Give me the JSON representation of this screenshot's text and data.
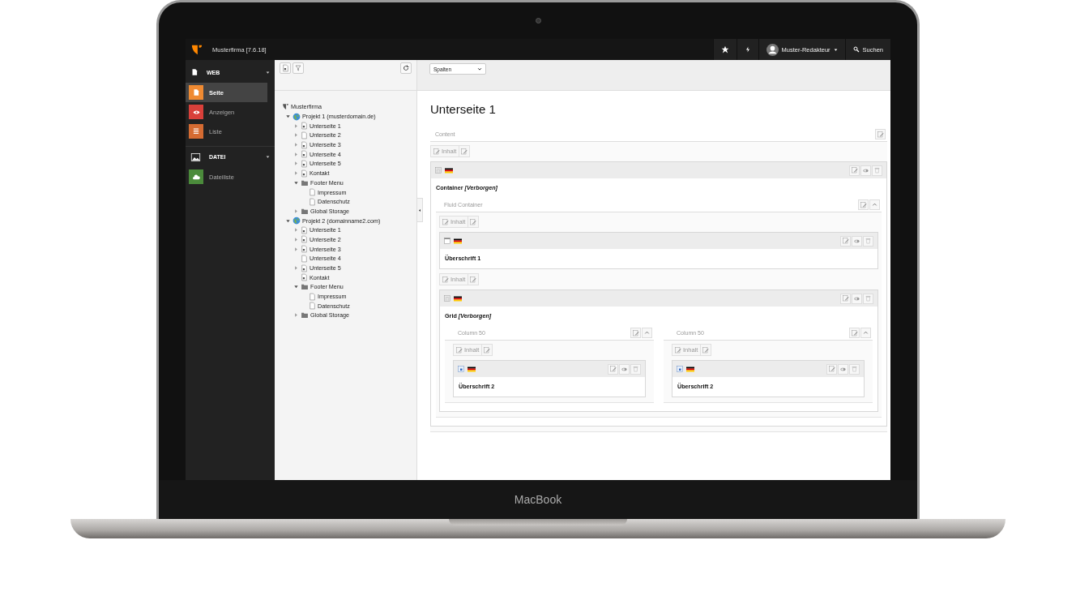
{
  "device_label": "MacBook",
  "topbar": {
    "title": "Musterfirma [7.6.18]",
    "user": "Muster-Redakteur",
    "search": "Suchen"
  },
  "modules": [
    {
      "label": "WEB",
      "kind": "page",
      "items": [
        {
          "label": "Seite",
          "kind": "page",
          "color": "#ef8a32",
          "selected": true
        },
        {
          "label": "Anzeigen",
          "kind": "eye",
          "color": "#d9403a",
          "selected": false
        },
        {
          "label": "Liste",
          "kind": "list",
          "color": "#d56b32",
          "selected": false
        }
      ]
    },
    {
      "label": "DATEI",
      "kind": "image",
      "items": [
        {
          "label": "Dateiliste",
          "kind": "cloud",
          "color": "#4b8b3b",
          "selected": false
        }
      ]
    }
  ],
  "tree": {
    "label": "Musterfirma",
    "kind": "root",
    "children": [
      {
        "label": "Projekt 1 (musterdomain.de)",
        "kind": "globe",
        "expanded": true,
        "children": [
          {
            "label": "Unterseite 1",
            "kind": "page",
            "expanded": false
          },
          {
            "label": "Unterseite 2",
            "kind": "page-plain",
            "expanded": false
          },
          {
            "label": "Unterseite 3",
            "kind": "page",
            "expanded": false
          },
          {
            "label": "Unterseite 4",
            "kind": "page",
            "expanded": false
          },
          {
            "label": "Unterseite 5",
            "kind": "page",
            "expanded": false
          },
          {
            "label": "Kontakt",
            "kind": "page",
            "expanded": false
          },
          {
            "label": "Footer Menu",
            "kind": "folder",
            "expanded": true,
            "children": [
              {
                "label": "Impressum",
                "kind": "page-plain"
              },
              {
                "label": "Datenschutz",
                "kind": "page-plain"
              }
            ]
          },
          {
            "label": "Global Storage",
            "kind": "folder",
            "expanded": false
          }
        ]
      },
      {
        "label": "Projekt 2 (domainname2.com)",
        "kind": "globe",
        "expanded": true,
        "children": [
          {
            "label": "Unterseite 1",
            "kind": "page",
            "expanded": false
          },
          {
            "label": "Unterseite 2",
            "kind": "page",
            "expanded": false
          },
          {
            "label": "Unterseite 3",
            "kind": "page",
            "expanded": false
          },
          {
            "label": "Unterseite 4",
            "kind": "page-plain"
          },
          {
            "label": "Unterseite 5",
            "kind": "page",
            "expanded": false
          },
          {
            "label": "Kontakt",
            "kind": "page"
          },
          {
            "label": "Footer Menu",
            "kind": "folder",
            "expanded": true,
            "children": [
              {
                "label": "Impressum",
                "kind": "page-plain"
              },
              {
                "label": "Datenschutz",
                "kind": "page-plain"
              }
            ]
          },
          {
            "label": "Global Storage",
            "kind": "folder",
            "expanded": false
          }
        ]
      }
    ]
  },
  "view_select": "Spalten",
  "page_title": "Unterseite 1",
  "column": {
    "label": "Content",
    "collapsible": false,
    "items": [
      {
        "kind": "add",
        "label": "Inhalt"
      },
      {
        "kind": "container",
        "title": "Container *[Verborgen]*",
        "columns": [
          {
            "label": "Fluid Container",
            "collapsible": true,
            "items": [
              {
                "kind": "add",
                "label": "Inhalt"
              },
              {
                "kind": "header",
                "title": "Überschrift 1"
              },
              {
                "kind": "add",
                "label": "Inhalt"
              },
              {
                "kind": "container",
                "title": "Grid *[Verborgen]*",
                "columns": [
                  {
                    "label": "Column 50",
                    "collapsible": true,
                    "items": [
                      {
                        "kind": "add",
                        "label": "Inhalt"
                      },
                      {
                        "kind": "textmedia",
                        "title": "Überschrift 2"
                      }
                    ]
                  },
                  {
                    "label": "Column 50",
                    "collapsible": true,
                    "items": [
                      {
                        "kind": "add",
                        "label": "Inhalt"
                      },
                      {
                        "kind": "textmedia",
                        "title": "Überschrift 2"
                      }
                    ]
                  }
                ]
              }
            ]
          }
        ]
      }
    ]
  }
}
